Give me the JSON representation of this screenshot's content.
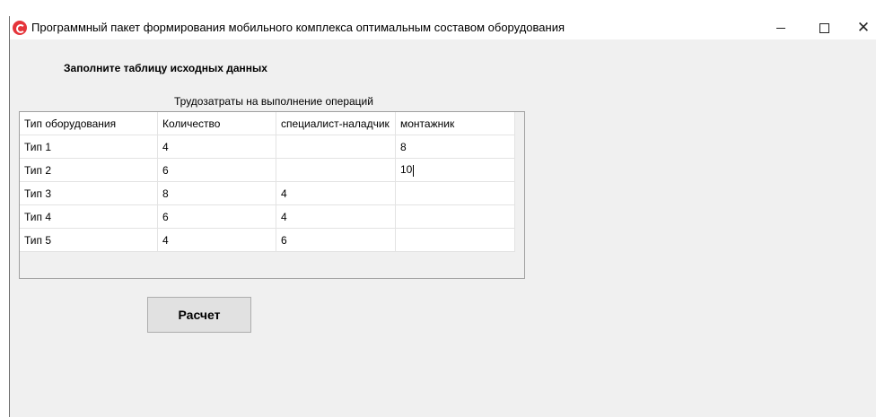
{
  "window": {
    "title": "Программный пакет формирования мобильного комплекса оптимальным составом оборудования",
    "accent": "#e5353b"
  },
  "form": {
    "instruction": "Заполните таблицу исходных данных",
    "table_caption": "Трудозатраты на выполнение операций",
    "columns": [
      "Тип оборудования",
      "Количество",
      "специалист-наладчик",
      "монтажник"
    ],
    "rows": [
      [
        "Тип 1",
        "4",
        "",
        "8"
      ],
      [
        "Тип 2",
        "6",
        "",
        "10"
      ],
      [
        "Тип 3",
        "8",
        "4",
        ""
      ],
      [
        "Тип 4",
        "6",
        "4",
        ""
      ],
      [
        "Тип 5",
        "4",
        "6",
        ""
      ]
    ],
    "calc_button_label": "Расчет"
  }
}
